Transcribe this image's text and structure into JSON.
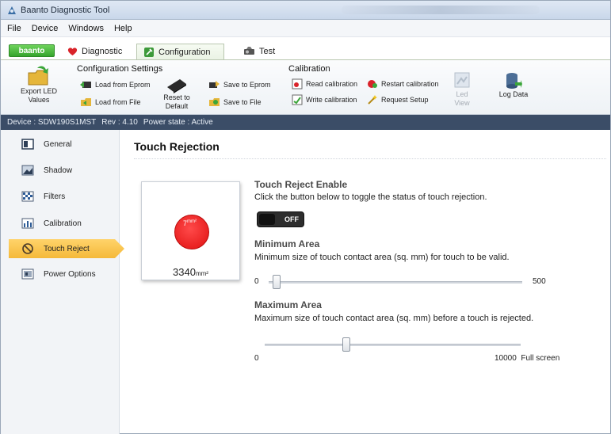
{
  "window": {
    "title": "Baanto Diagnostic Tool"
  },
  "menu": [
    "File",
    "Device",
    "Windows",
    "Help"
  ],
  "brand": "baanto",
  "tabs": [
    {
      "label": "Diagnostic",
      "icon": "heart-icon"
    },
    {
      "label": "Configuration",
      "icon": "wrench-icon",
      "active": true
    },
    {
      "label": "Test",
      "icon": "test-icon"
    }
  ],
  "ribbon": {
    "export": {
      "line1": "Export LED",
      "line2": "Values"
    },
    "config_title": "Configuration Settings",
    "load_eprom": "Load from Eprom",
    "load_file": "Load from File",
    "reset_default": "Reset to Default",
    "save_eprom": "Save to Eprom",
    "save_file": "Save to File",
    "calibration_title": "Calibration",
    "read_cal": "Read calibration",
    "write_cal": "Write calibration",
    "restart_cal": "Restart calibration",
    "request_setup": "Request Setup",
    "led_view": "Led View",
    "log_data": "Log Data"
  },
  "device": {
    "device": "Device : SDW190S1MST",
    "rev": "Rev : 4.10",
    "power": "Power state : Active"
  },
  "sidebar": [
    {
      "label": "General",
      "icon": "general-icon"
    },
    {
      "label": "Shadow",
      "icon": "shadow-icon"
    },
    {
      "label": "Filters",
      "icon": "filters-icon"
    },
    {
      "label": "Calibration",
      "icon": "calibration-icon"
    },
    {
      "label": "Touch Reject",
      "icon": "no-symbol-icon",
      "active": true
    },
    {
      "label": "Power Options",
      "icon": "power-options-icon"
    }
  ],
  "main": {
    "title": "Touch Rejection",
    "preview_blob_value": "7",
    "preview_blob_unit": "mm²",
    "preview_area_value": "3340",
    "preview_area_unit": "mm²",
    "enable_title": "Touch Reject Enable",
    "enable_desc": "Click the button below to toggle the status of touch rejection.",
    "toggle_label": "OFF",
    "min_title": "Minimum Area",
    "min_desc": "Minimum size of touch contact area (sq. mm) for touch to be valid.",
    "min_low": "0",
    "min_high": "500",
    "min_level": 0.03,
    "max_title": "Maximum Area",
    "max_desc": "Maximum size of touch contact area (sq. mm) before a touch is rejected.",
    "max_low": "0",
    "max_high": "10000",
    "max_high_suffix": "Full screen",
    "max_level": 0.32
  }
}
